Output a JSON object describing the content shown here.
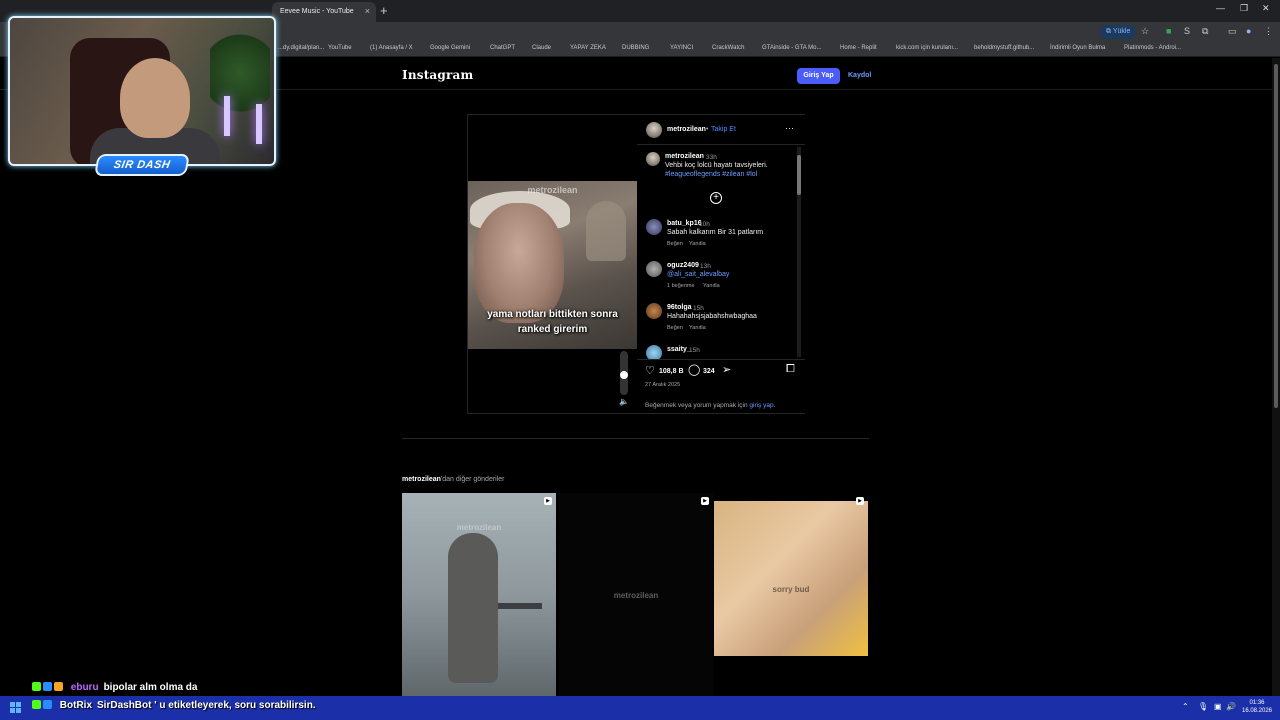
{
  "browser": {
    "tab_title": "Eevee Music - YouTube",
    "tab_close": "×",
    "new_tab": "+",
    "install_label": "Yükle",
    "bookmarks": [
      "...dy.digital/plan...",
      "YouTube",
      "(1) Anasayfa / X",
      "Google Gemini",
      "ChatGPT",
      "Claude",
      "YAPAY ZEKA",
      "DUBBING",
      "YAYINCI",
      "CrackWatch",
      "GTAinside - GTA Mo...",
      "Home - Replit",
      "kick.com için kurulanı...",
      "beholdmystuff.github...",
      "İndirimli Oyun Bulma",
      "Platinmods - Androi..."
    ]
  },
  "instagram": {
    "logo": "Instagram",
    "login_button": "Giriş Yap",
    "signup_link": "Kaydol",
    "post": {
      "author": "metrozilean",
      "follow_sep": "•",
      "follow": "Takip Et",
      "more_icon": "···",
      "video_watermark": "metrozilean",
      "video_subtitle_line1": "yama notları bittikten sonra",
      "video_subtitle_line2": "ranked girerim",
      "caption_user": "metrozilean",
      "caption_time": "33h",
      "caption_text": "Vehbi koç lolcü hayatı tavsiyeleri.",
      "caption_tags": "#leagueoflegends #zilean #lol",
      "comments": [
        {
          "user": "batu_kp16",
          "time": "10h",
          "text": "Sabah kalkarım Bir 31 patlarım",
          "meta1": "Beğen",
          "meta2": "Yanıtla"
        },
        {
          "user": "oguz2409",
          "time": "13h",
          "text": "@ali_sait_alevalbay",
          "meta1": "1 beğenme",
          "meta2": "Yanıtla"
        },
        {
          "user": "96tolga",
          "time": "15h",
          "text": "Hahahahsjsjabahshwbaghaa",
          "meta1": "Beğen",
          "meta2": "Yanıtla"
        },
        {
          "user": "ssaity_",
          "time": "15h",
          "text": "",
          "meta1": "",
          "meta2": ""
        }
      ],
      "likes": "108,8 B",
      "comment_count": "324",
      "date": "27 Aralık 2025",
      "login_note_prefix": "Beğenmek veya yorum yapmak için",
      "login_note_link": "giriş yap."
    },
    "more_posts_user": "metrozilean",
    "more_posts_suffix": "'dan diğer gönderiler",
    "tiles": [
      {
        "watermark": "metrozilean"
      },
      {
        "watermark": "metrozilean"
      },
      {
        "watermark": "sorry bud"
      }
    ]
  },
  "stream": {
    "badge": "SIR DASH",
    "chat": [
      {
        "user": "eburu",
        "message": "bipolar alm olma da",
        "user_color": "#c066ff"
      },
      {
        "user": "BotRix",
        "message": "SirDashBot ' u etiketleyerek, soru sorabilirsin.",
        "user_color": "#ffffff"
      }
    ]
  },
  "taskbar": {
    "time": "01:36",
    "date": "16.08.2026"
  },
  "colors": {
    "accent_blue": "#4a5df9",
    "link_blue": "#6b9cff",
    "taskbar": "#1a2fa8"
  }
}
